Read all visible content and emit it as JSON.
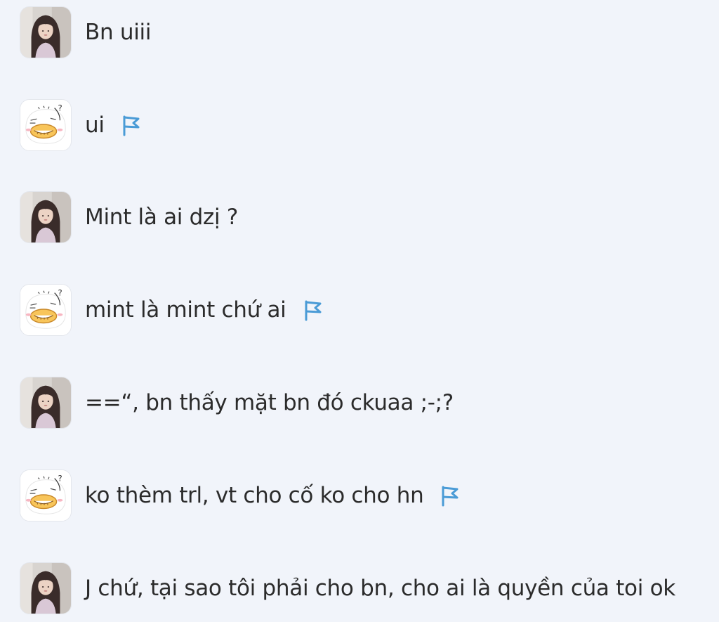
{
  "messages": [
    {
      "sender": "girl",
      "text": "Bn uiii",
      "flagged": false
    },
    {
      "sender": "duck",
      "text": "ui",
      "flagged": true
    },
    {
      "sender": "girl",
      "text": "Mint là ai dzị ?",
      "flagged": false
    },
    {
      "sender": "duck",
      "text": "mint là mint chứ ai",
      "flagged": true
    },
    {
      "sender": "girl",
      "text": "==“, bn thấy mặt bn đó ckuaa ;-;?",
      "flagged": false
    },
    {
      "sender": "duck",
      "text": "ko thèm trl, vt cho cố ko cho hn",
      "flagged": true
    },
    {
      "sender": "girl",
      "text": "J chứ, tại sao tôi phải cho bn, cho ai là quyền của toi ok",
      "flagged": false
    }
  ],
  "icons": {
    "flag": "flag-icon",
    "girl_avatar": "user-avatar-photo",
    "duck_avatar": "duck-cartoon-avatar"
  },
  "colors": {
    "background": "#f1f4fa",
    "text": "#2b2b2b",
    "flag": "#4a9bd6"
  }
}
